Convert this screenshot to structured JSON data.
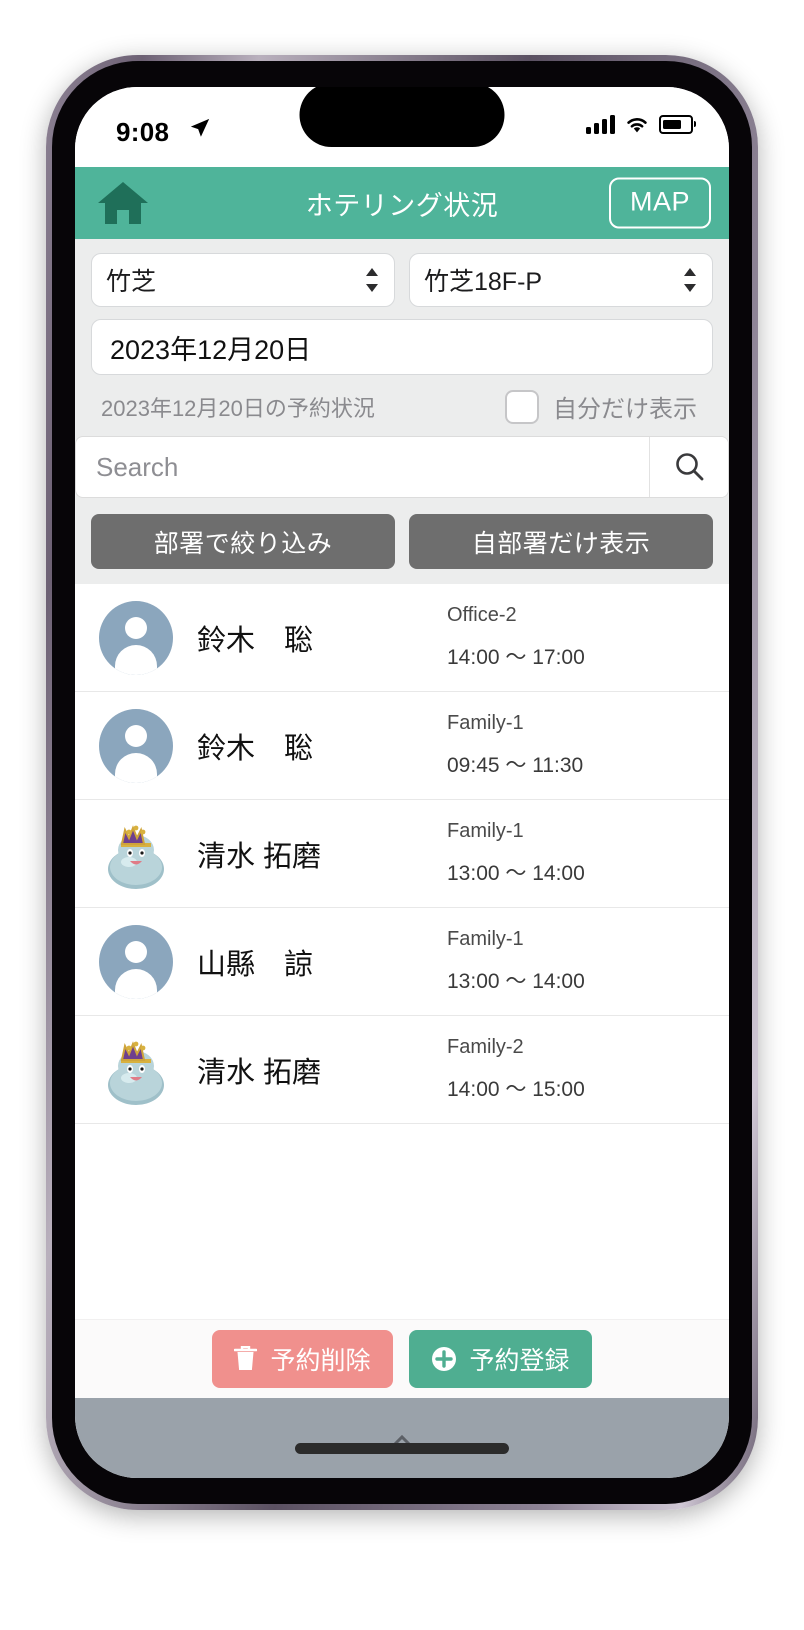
{
  "status_bar": {
    "time": "9:08",
    "location_icon": "location-arrow-icon",
    "signal_icon": "cellular-bars-icon",
    "wifi_icon": "wifi-icon",
    "battery_icon": "battery-icon"
  },
  "header": {
    "home_icon": "home-icon",
    "title": "ホテリング状況",
    "map_label": "MAP",
    "accent_color": "#4fb49a"
  },
  "filters": {
    "site_select": {
      "value": "竹芝",
      "chevron": "⌃⌄"
    },
    "floor_select": {
      "value": "竹芝18F-P",
      "chevron": "⌃⌄"
    },
    "date_field": {
      "value": "2023年12月20日"
    },
    "status_label": "2023年12月20日の予約状況",
    "own_only_label": "自分だけ表示",
    "own_only_checked": false,
    "search": {
      "value": "",
      "placeholder": "Search",
      "icon": "search-icon"
    },
    "buttons": [
      {
        "label": "部署で絞り込み",
        "name": "filter-by-department-button"
      },
      {
        "label": "自部署だけ表示",
        "name": "own-department-only-button"
      }
    ]
  },
  "reservations": [
    {
      "avatar": "person-avatar",
      "name": "鈴木　聡",
      "room": "Office-2",
      "time": "14:00 ～ 17:00"
    },
    {
      "avatar": "person-avatar",
      "name": "鈴木　聡",
      "room": "Family-1",
      "time": "09:45 ～ 11:30"
    },
    {
      "avatar": "slime-avatar",
      "name": "清水 拓磨",
      "room": "Family-1",
      "time": "13:00 ～ 14:00"
    },
    {
      "avatar": "person-avatar",
      "name": "山縣　諒",
      "room": "Family-1",
      "time": "13:00 ～ 14:00"
    },
    {
      "avatar": "slime-avatar",
      "name": "清水 拓磨",
      "room": "Family-2",
      "time": "14:00 ～ 15:00"
    }
  ],
  "bottom_actions": {
    "delete": {
      "label": "予約削除",
      "icon": "trash-icon",
      "color": "#f0908d"
    },
    "add": {
      "label": "予約登録",
      "icon": "plus-circle-icon",
      "color": "#4fae91"
    }
  }
}
